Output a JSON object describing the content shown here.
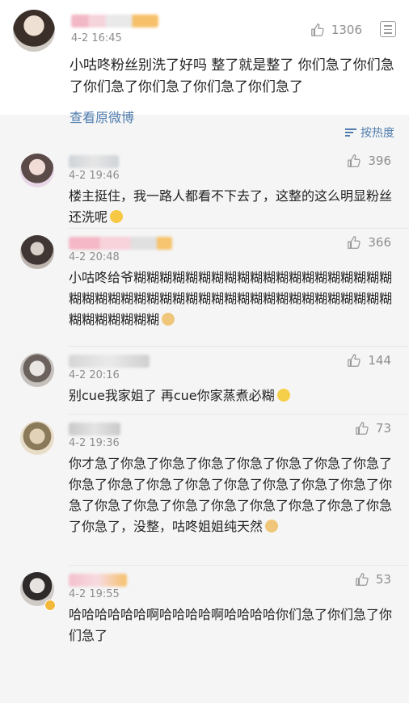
{
  "post": {
    "time": "4-2 16:45",
    "likes": "1306",
    "body": "小咕咚粉丝别洗了好吗 整了就是整了 你们急了你们急了你们急了你们急了你们急了你们急了",
    "view_original": "查看原微博"
  },
  "sort": {
    "label": "按热度"
  },
  "comments": [
    {
      "time": "4-2 19:46",
      "likes": "396",
      "text": "楼主挺住，我一路人都看不下去了，这整的这么明显粉丝还洗呢"
    },
    {
      "time": "4-2 20:48",
      "likes": "366",
      "text": "小咕咚给爷糊糊糊糊糊糊糊糊糊糊糊糊糊糊糊糊糊糊糊糊糊糊糊糊糊糊糊糊糊糊糊糊糊糊糊糊糊糊糊糊糊糊糊糊糊糊糊糊糊糊糊糊"
    },
    {
      "time": "4-2 20:16",
      "likes": "144",
      "text": "别cue我家姐了 再cue你家蒸煮必糊"
    },
    {
      "time": "4-2 19:36",
      "likes": "73",
      "text": "你才急了你急了你急了你急了你急了你急了你急了你急了你急了你急了你急了你急了你急了你急了你急了你急了你急了你急了你急了你急了你急了你急了你急了你急了你急了你急了，没整，咕咚姐姐纯天然"
    },
    {
      "time": "4-2 19:55",
      "likes": "53",
      "text": "哈哈哈哈哈哈啊哈哈哈哈啊哈哈哈哈你们急了你们急了你们急了"
    }
  ],
  "colors": {
    "link": "#507daf",
    "meta": "#8d8d8d",
    "text": "#222222"
  }
}
